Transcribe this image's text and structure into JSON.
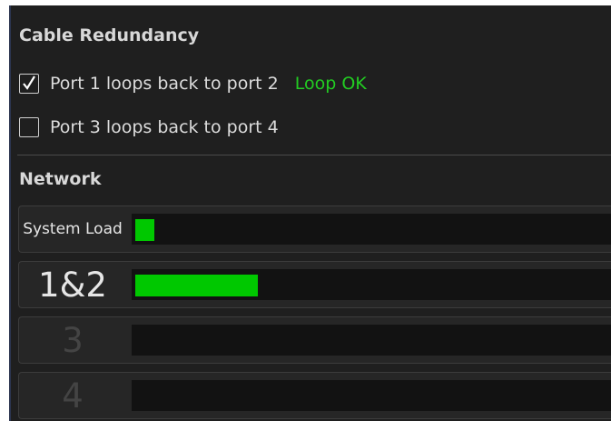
{
  "cable_redundancy": {
    "title": "Cable Redundancy",
    "ports": [
      {
        "label": "Port 1 loops back to port 2",
        "checked": true,
        "status": "Loop OK",
        "status_color": "#22cc22"
      },
      {
        "label": "Port 3 loops back to port 4",
        "checked": false,
        "status": ""
      }
    ]
  },
  "network": {
    "title": "Network",
    "accent_color": "#00c800",
    "rows": [
      {
        "label": "System Load",
        "level_percent": 4,
        "active": true
      },
      {
        "label": "1&2",
        "level_percent": 26,
        "active": true
      },
      {
        "label": "3",
        "level_percent": 0,
        "active": false
      },
      {
        "label": "4",
        "level_percent": 0,
        "active": false
      }
    ]
  }
}
